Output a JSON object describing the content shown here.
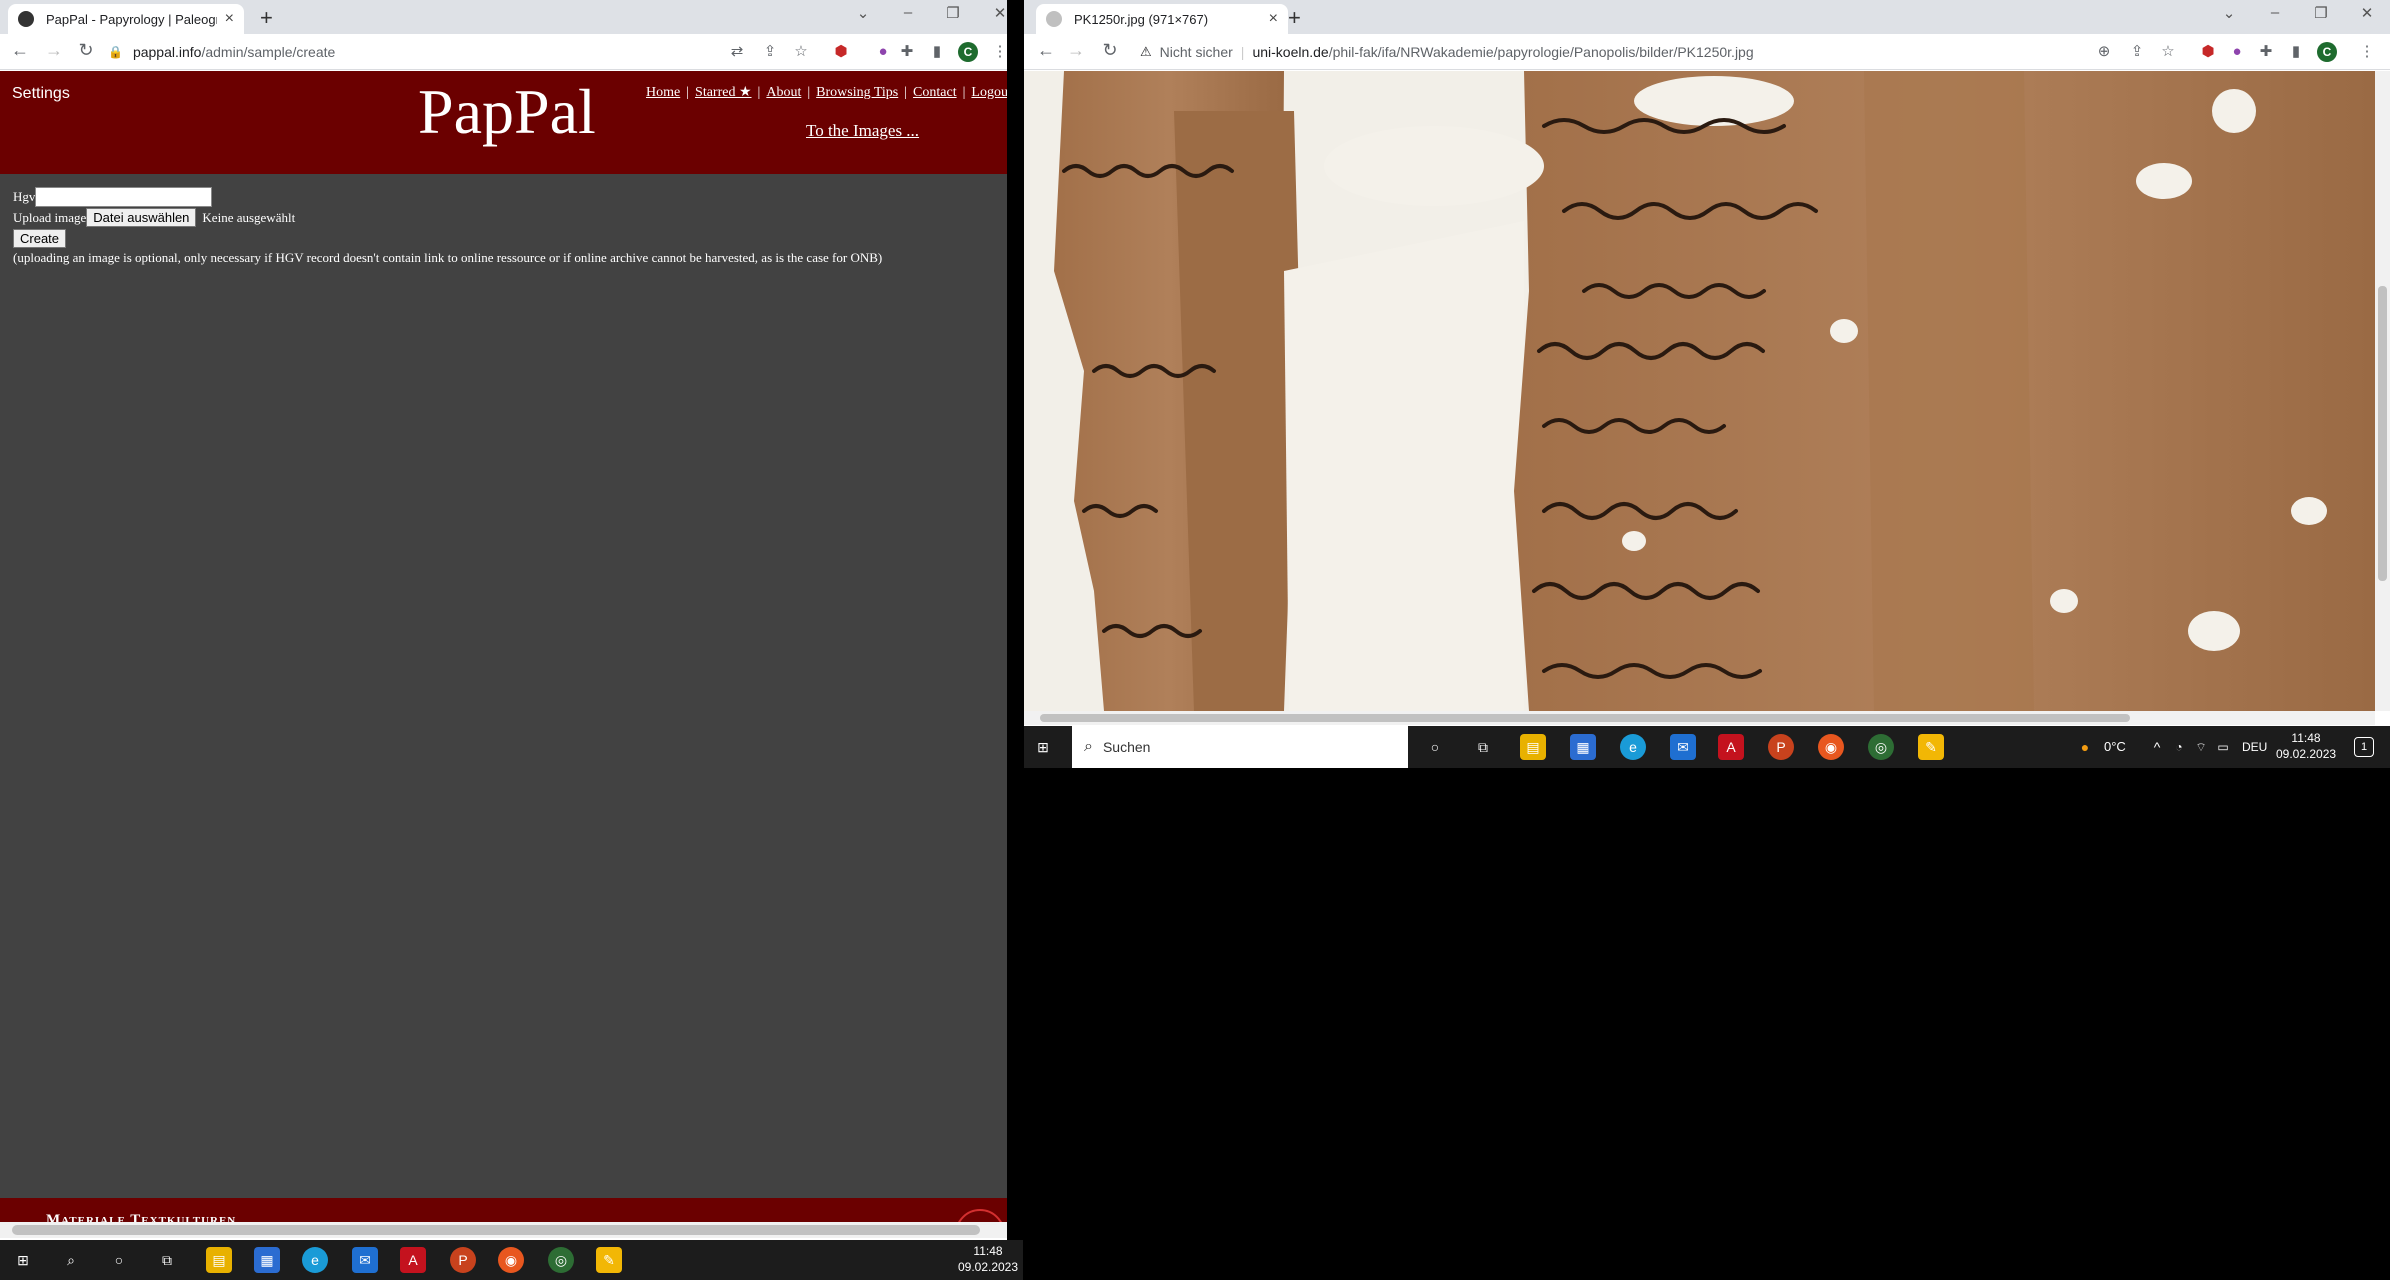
{
  "left_window": {
    "tab_title": "PapPal - Papyrology | Paleograph",
    "new_tab": "+",
    "url_host": "pappal.info",
    "url_path": "/admin/sample/create",
    "profile_letter": "C",
    "header": {
      "settings": "Settings",
      "logo": "PapPal",
      "nav": [
        "Home",
        "Starred ★",
        "About",
        "Browsing Tips",
        "Contact",
        "Logou"
      ],
      "to_images": "To the Images ..."
    },
    "form": {
      "hgv_label": "Hgv",
      "hgv_value": "",
      "upload_label": "Upload image",
      "file_button": "Datei auswählen",
      "file_status": "Keine ausgewählt",
      "create_button": "Create",
      "note": "(uploading an image is optional, only necessary if HGV record doesn't contain link to online ressource or if online archive cannot be harvested, as is the case for ONB)"
    },
    "footer_text": "Materiale Textkulturen"
  },
  "right_window": {
    "tab_title": "PK1250r.jpg (971×767)",
    "new_tab": "+",
    "security_label": "Nicht sicher",
    "url_host": "uni-koeln.de",
    "url_path": "/phil-fak/ifa/NRWakademie/papyrologie/Panopolis/bilder/PK1250r.jpg",
    "profile_letter": "C"
  },
  "taskbar_left": {
    "time": "11:48",
    "date": "09.02.2023"
  },
  "taskbar_right": {
    "search_placeholder": "Suchen",
    "temperature": "0°C",
    "language": "DEU",
    "time": "11:48",
    "date": "09.02.2023",
    "notification_count": "1"
  },
  "colors": {
    "pappal_red": "#6b0000",
    "pappal_body": "#424242",
    "papyrus": "#a8784a"
  }
}
